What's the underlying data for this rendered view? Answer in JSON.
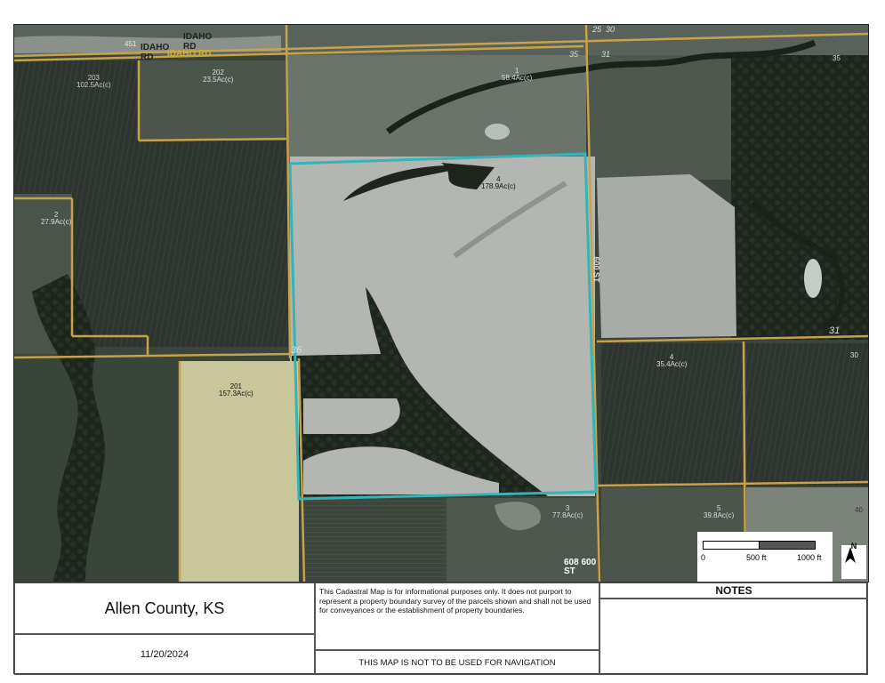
{
  "map": {
    "parcels": [
      {
        "id": "p451",
        "text": "451"
      },
      {
        "id": "p203",
        "text": "203\n102.5Ac(c)"
      },
      {
        "id": "p202",
        "text": "202\n23.5Ac(c)"
      },
      {
        "id": "p1",
        "text": "1\n58.4Ac(c)"
      },
      {
        "id": "p4",
        "text": "4\n178.9Ac(c)"
      },
      {
        "id": "p2",
        "text": "2\n27.9Ac(c)"
      },
      {
        "id": "p201",
        "text": "201\n157.3Ac(c)"
      },
      {
        "id": "p4b",
        "text": "4\n35.4Ac(c)"
      },
      {
        "id": "p3",
        "text": "3\n77.8Ac(c)"
      },
      {
        "id": "p5",
        "text": "5\n39.8Ac(c)"
      },
      {
        "id": "p40",
        "text": "40"
      },
      {
        "id": "p30",
        "text": "30"
      },
      {
        "id": "p35",
        "text": "35"
      }
    ],
    "roads": {
      "idaho1": "IDAHO\nRD",
      "idaho2": "IDAHO\nRD",
      "idaho3": "IDAHO RD",
      "st600": "600 ST",
      "st608": "608 600\nST"
    },
    "sections": {
      "s36": "36",
      "s31": "31",
      "s25": "25",
      "s30": "30",
      "s31b": "31",
      "s35": "35"
    },
    "scale": {
      "zero": "0",
      "mid": "500 ft",
      "max": "1000 ft"
    },
    "north": "N",
    "highlight_color": "#35b3b8",
    "road_color": "#c8a24a"
  },
  "footer": {
    "county": "Allen County, KS",
    "date": "11/20/2024",
    "disclaimer": "This Cadastral Map is for informational purposes only.  It does not purport to represent a property boundary survey of the parcels shown and shall not be used for conveyances or the establishment of property boundaries.",
    "nav_warning": "THIS MAP IS NOT TO BE USED FOR NAVIGATION",
    "notes_title": "NOTES"
  }
}
